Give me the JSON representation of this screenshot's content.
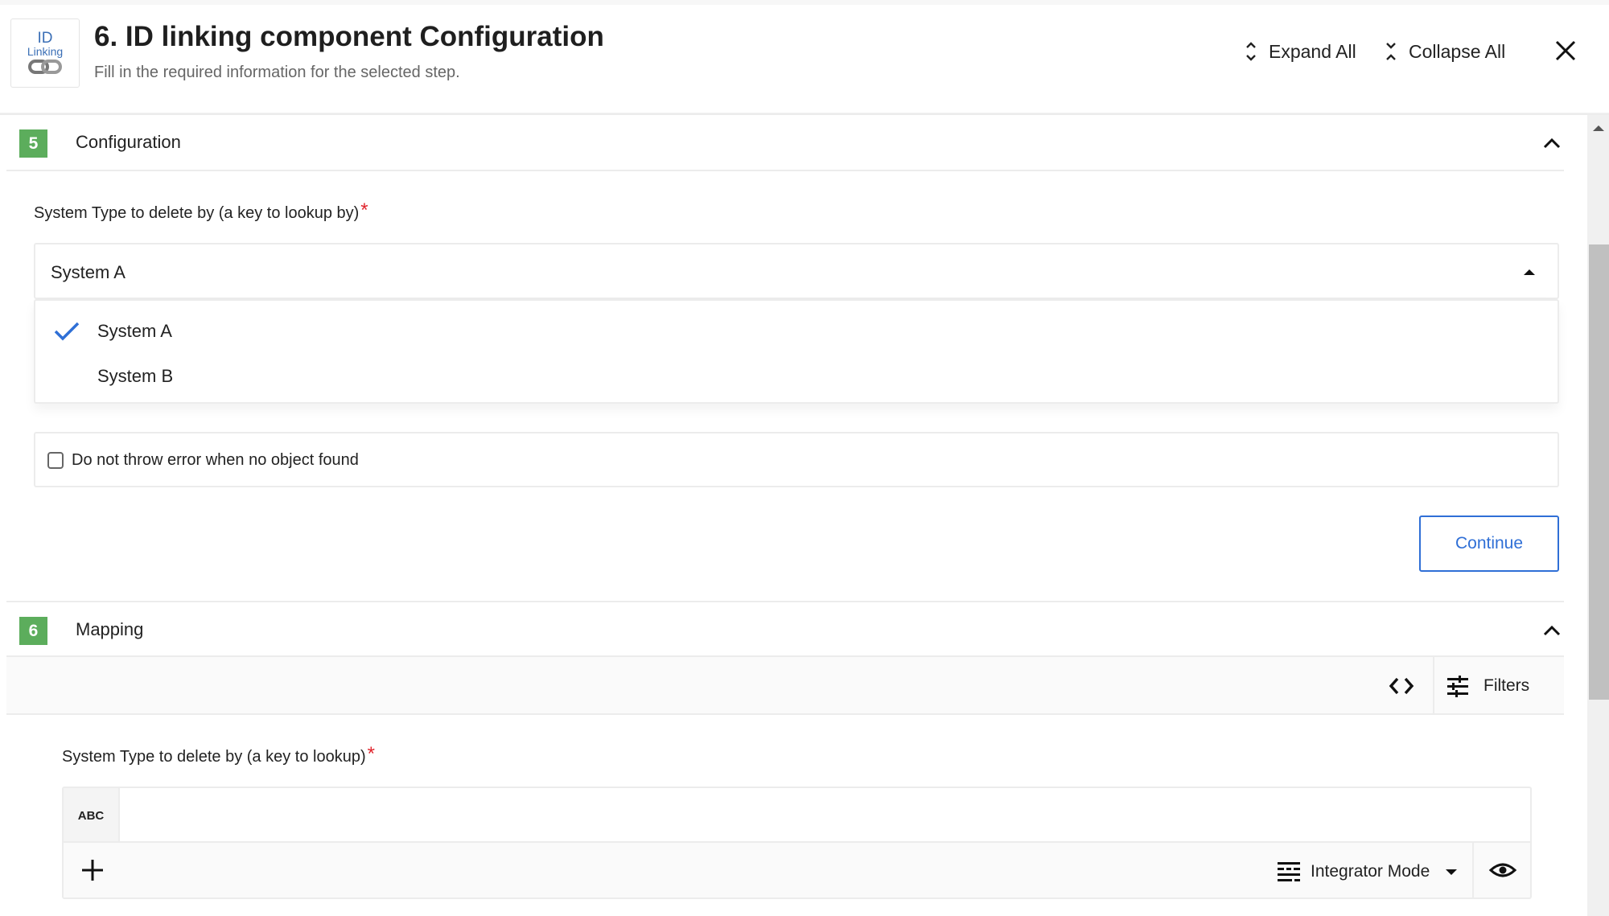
{
  "header": {
    "logo_line1": "ID",
    "logo_line2": "Linking",
    "title": "6. ID linking component Configuration",
    "subtitle": "Fill in the required information for the selected step.",
    "expand_all": "Expand All",
    "collapse_all": "Collapse All"
  },
  "sections": [
    {
      "number": "5",
      "title": "Configuration",
      "badge_color": "#5cad5c",
      "field_label": "System Type to delete by (a key to lookup by)",
      "required_mark": "*",
      "select": {
        "value": "System A",
        "options": [
          {
            "label": "System A",
            "selected": true
          },
          {
            "label": "System B",
            "selected": false
          }
        ]
      },
      "checkbox": {
        "label": "Do not throw error when no object found",
        "checked": false
      },
      "continue_label": "Continue"
    },
    {
      "number": "6",
      "title": "Mapping",
      "badge_color": "#5cad5c",
      "toolbar": {
        "filters_label": "Filters"
      },
      "field_label": "System Type to delete by (a key to lookup)",
      "required_mark": "*",
      "type_tag": "ABC",
      "input_value": "",
      "mode_label": "Integrator Mode"
    }
  ],
  "colors": {
    "accent": "#2f6fd6",
    "required": "#e0242c",
    "badge": "#5cad5c"
  }
}
